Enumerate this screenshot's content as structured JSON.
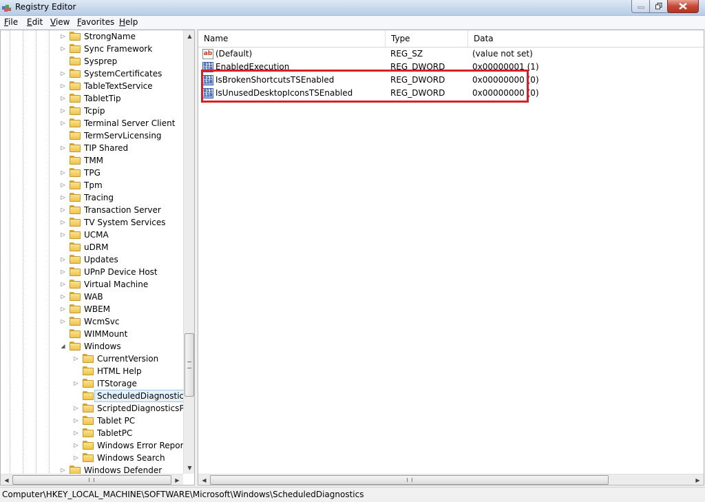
{
  "window": {
    "title": "Registry Editor"
  },
  "menu": [
    "File",
    "Edit",
    "View",
    "Favorites",
    "Help"
  ],
  "tree": {
    "items": [
      {
        "label": "StrongName",
        "expander": "▷"
      },
      {
        "label": "Sync Framework",
        "expander": "▷"
      },
      {
        "label": "Sysprep",
        "expander": ""
      },
      {
        "label": "SystemCertificates",
        "expander": "▷"
      },
      {
        "label": "TableTextService",
        "expander": "▷"
      },
      {
        "label": "TabletTip",
        "expander": "▷"
      },
      {
        "label": "Tcpip",
        "expander": "▷"
      },
      {
        "label": "Terminal Server Client",
        "expander": "▷"
      },
      {
        "label": "TermServLicensing",
        "expander": ""
      },
      {
        "label": "TIP Shared",
        "expander": "▷"
      },
      {
        "label": "TMM",
        "expander": ""
      },
      {
        "label": "TPG",
        "expander": "▷"
      },
      {
        "label": "Tpm",
        "expander": "▷"
      },
      {
        "label": "Tracing",
        "expander": "▷"
      },
      {
        "label": "Transaction Server",
        "expander": "▷"
      },
      {
        "label": "TV System Services",
        "expander": "▷"
      },
      {
        "label": "UCMA",
        "expander": "▷"
      },
      {
        "label": "uDRM",
        "expander": ""
      },
      {
        "label": "Updates",
        "expander": "▷"
      },
      {
        "label": "UPnP Device Host",
        "expander": "▷"
      },
      {
        "label": "Virtual Machine",
        "expander": "▷"
      },
      {
        "label": "WAB",
        "expander": "▷"
      },
      {
        "label": "WBEM",
        "expander": "▷"
      },
      {
        "label": "WcmSvc",
        "expander": "▷"
      },
      {
        "label": "WIMMount",
        "expander": ""
      },
      {
        "label": "Windows",
        "expander": "◢"
      }
    ],
    "children": [
      {
        "label": "CurrentVersion",
        "expander": "▷"
      },
      {
        "label": "HTML Help",
        "expander": ""
      },
      {
        "label": "ITStorage",
        "expander": "▷"
      },
      {
        "label": "ScheduledDiagnostics",
        "expander": "",
        "selected": true
      },
      {
        "label": "ScriptedDiagnosticsProv",
        "expander": "▷"
      },
      {
        "label": "Tablet PC",
        "expander": "▷"
      },
      {
        "label": "TabletPC",
        "expander": "▷"
      },
      {
        "label": "Windows Error Reportin",
        "expander": "▷"
      },
      {
        "label": "Windows Search",
        "expander": "▷"
      }
    ],
    "after": [
      {
        "label": "Windows Defender",
        "expander": "▷"
      }
    ]
  },
  "list": {
    "columns": [
      "Name",
      "Type",
      "Data"
    ],
    "rows": [
      {
        "icon": "ab",
        "name": "(Default)",
        "type": "REG_SZ",
        "data": "(value not set)"
      },
      {
        "icon": "011\n110",
        "name": "EnabledExecution",
        "type": "REG_DWORD",
        "data": "0x00000001 (1)"
      },
      {
        "icon": "011\n110",
        "name": "IsBrokenShortcutsTSEnabled",
        "type": "REG_DWORD",
        "data": "0x00000000 (0)"
      },
      {
        "icon": "011\n110",
        "name": "IsUnusedDesktopIconsTSEnabled",
        "type": "REG_DWORD",
        "data": "0x00000000 (0)"
      }
    ]
  },
  "status": {
    "path": "Computer\\HKEY_LOCAL_MACHINE\\SOFTWARE\\Microsoft\\Windows\\ScheduledDiagnostics"
  },
  "colors": {
    "highlight": "#d91f26",
    "selection": "#e5f1fb"
  }
}
